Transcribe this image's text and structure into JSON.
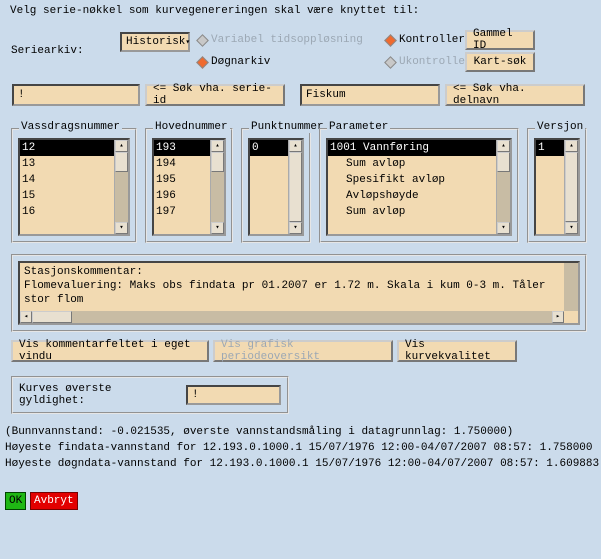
{
  "title": "Velg serie-nøkkel som kurvegenereringen skal være knyttet til:",
  "archive_label": "Seriearkiv:",
  "archive_dropdown": "Historisk",
  "options": {
    "var_tid": "Variabel tidsoppløsning",
    "dogn": "Døgnarkiv",
    "kontrollert": "Kontrollert",
    "ukontrollert": "Ukontrollert"
  },
  "buttons": {
    "gammel_id": "Gammel ID",
    "kart_sok": "Kart-søk",
    "sok_serie": "<= Søk vha. serie-id",
    "sok_delnavn": "<= Søk vha. delnavn",
    "vis_kommentar": "Vis kommentarfeltet i eget vindu",
    "vis_grafisk": "Vis grafisk periodeoversikt",
    "vis_kurvekvalitet": "Vis kurvekvalitet",
    "ok": "OK",
    "avbryt": "Avbryt"
  },
  "inputs": {
    "serie_id": "!",
    "delnavn": "Fiskum",
    "gyldighet": "!"
  },
  "panels": {
    "vassdragsnummer": {
      "label": "Vassdragsnummer",
      "items": [
        "12",
        "13",
        "14",
        "15",
        "16"
      ],
      "selected": 0
    },
    "hovednummer": {
      "label": "Hovednummer",
      "items": [
        "193",
        "194",
        "195",
        "196",
        "197"
      ],
      "selected": 0
    },
    "punktnummer": {
      "label": "Punktnummer",
      "items": [
        "0"
      ],
      "selected": 0
    },
    "parameter": {
      "label": "Parameter",
      "items": [
        "1001 Vannføring",
        "Sum avløp",
        "Spesifikt avløp",
        "Avløpshøyde",
        "Sum avløp"
      ],
      "selected": 0
    },
    "versjon": {
      "label": "Versjon",
      "items": [
        "1"
      ],
      "selected": 0
    }
  },
  "comment": {
    "header": "Stasjonskommentar:",
    "line1": "Flomevaluering: Maks obs findata pr 01.2007 er 1.72 m. Skala i kum 0-3 m. Tåler",
    "line2": "  stor flom"
  },
  "gyldighet_label": "Kurves øverste gyldighet:",
  "footer": {
    "l1": "(Bunnvannstand: -0.021535, øverste vannstandsmåling i datagrunnlag: 1.750000)",
    "l2": "Høyeste findata-vannstand for 12.193.0.1000.1 15/07/1976 12:00-04/07/2007 08:57: 1.758000",
    "l3": "Høyeste døgndata-vannstand for 12.193.0.1000.1 15/07/1976 12:00-04/07/2007 08:57: 1.609883"
  }
}
